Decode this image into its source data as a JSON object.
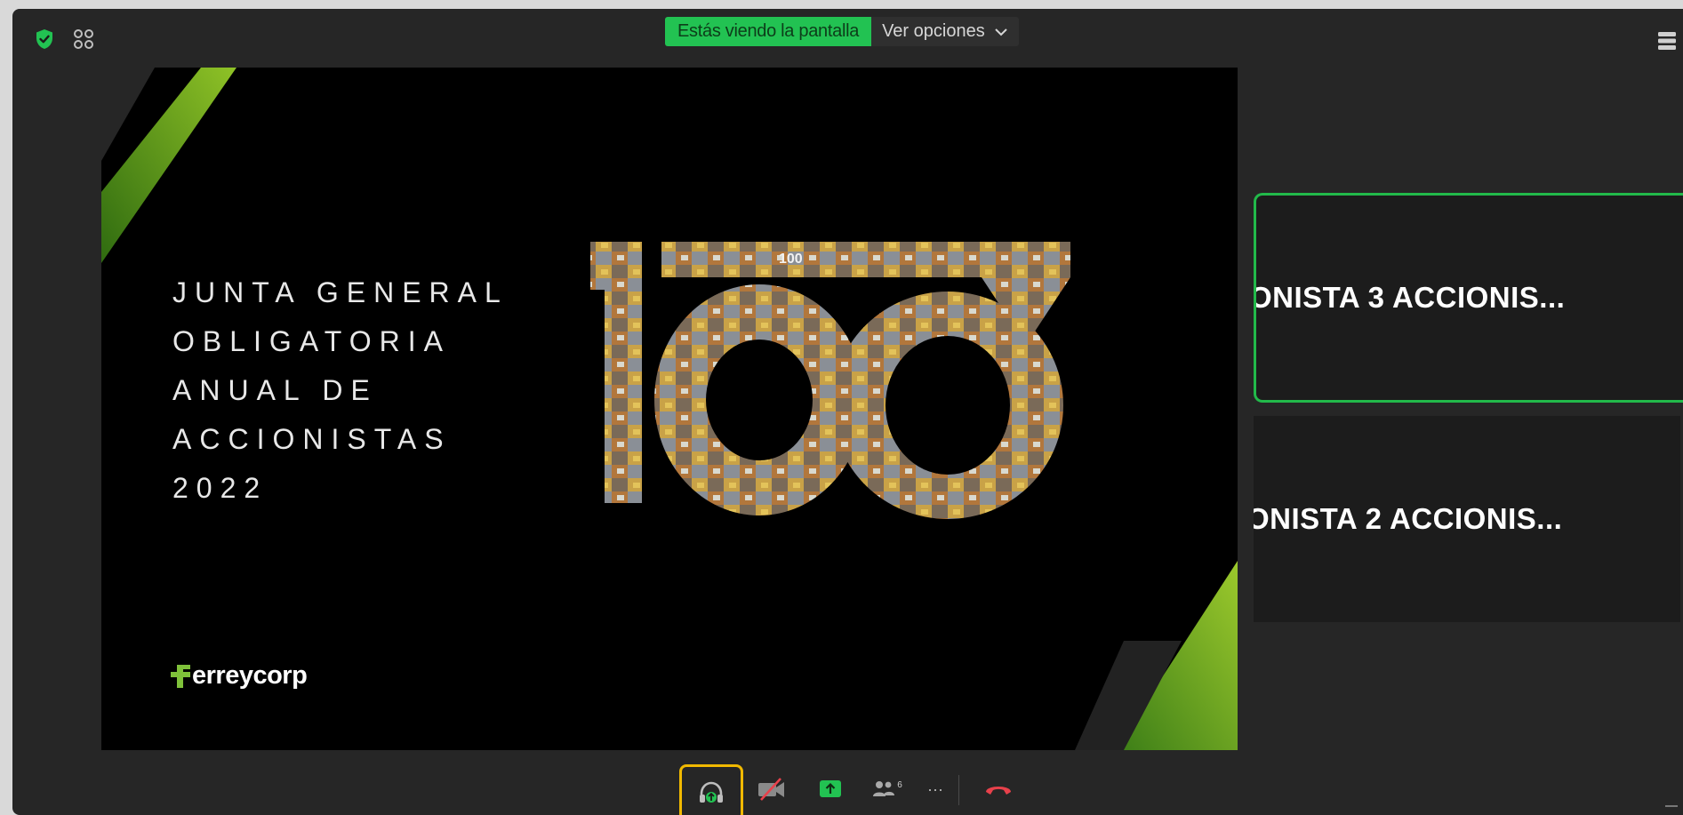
{
  "share_bar": {
    "status_text": "Estás viendo la pantalla",
    "options_label": "Ver opciones"
  },
  "slide": {
    "title_lines": [
      "JUNTA GENERAL",
      "OBLIGATORIA",
      "ANUAL DE",
      "ACCIONISTAS",
      "2022"
    ],
    "centennial_text": "100",
    "brand": "erreycorp"
  },
  "participants": [
    {
      "name": "ONISTA 3 ACCIONIS...",
      "active": true
    },
    {
      "name": "ONISTA 2 ACCIONIS...",
      "active": false
    }
  ],
  "toolbar": {
    "participant_count": "6",
    "more_label": "···"
  },
  "colors": {
    "accent_green": "#22c252",
    "highlight_orange": "#f1b900",
    "end_red": "#e8414b"
  }
}
